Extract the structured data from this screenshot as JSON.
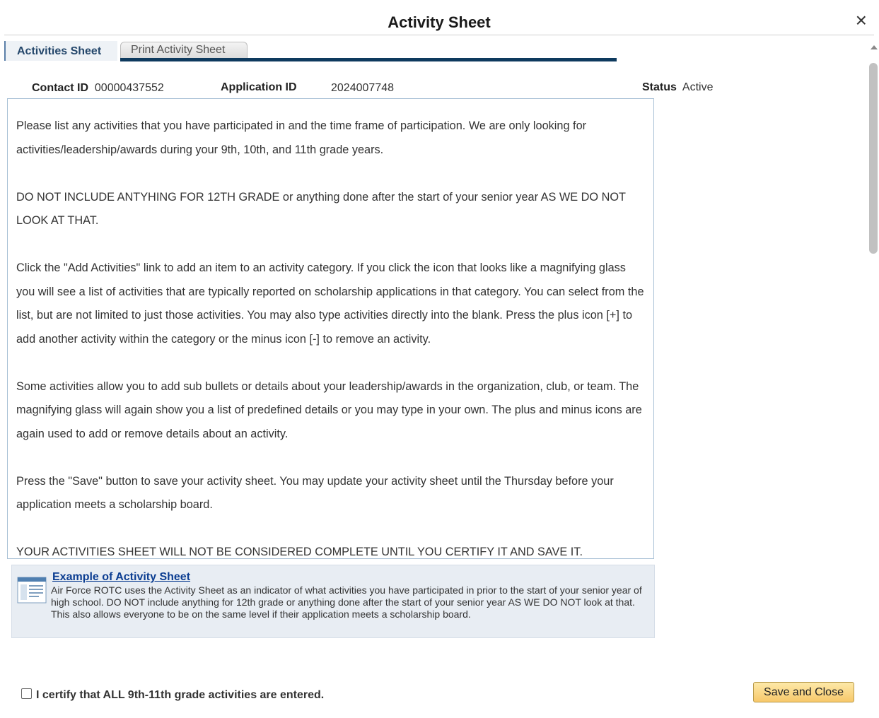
{
  "dialog": {
    "title": "Activity Sheet",
    "close_glyph": "×"
  },
  "tabs": [
    {
      "label": "Activities Sheet",
      "active": true
    },
    {
      "label": "Print Activity Sheet",
      "active": false
    }
  ],
  "ids": {
    "contact_label": "Contact ID",
    "contact_value": "00000437552",
    "application_label": "Application ID",
    "application_value": "2024007748",
    "status_label": "Status",
    "status_value": "Active"
  },
  "instructions": [
    "Please list any activities that you have participated in and the time frame of participation. We are only looking for activities/leadership/awards during your 9th, 10th, and 11th grade years.",
    "DO NOT INCLUDE ANTYHING FOR 12TH GRADE or anything done after the start of your senior year AS WE DO NOT LOOK AT THAT.",
    "Click the \"Add Activities\" link to add an item to an activity category. If you click the icon that looks like a magnifying glass you will see a list of activities that are typically reported on scholarship applications in that category. You can select from the list, but are not limited to just those activities. You may also type activities directly into the blank. Press the plus icon [+] to add another activity within the category or the minus icon [-] to remove an activity.",
    "Some activities allow you to add sub bullets or details about your leadership/awards in the organization, club, or team. The magnifying glass will again show you a list of predefined details or you may type in your own. The plus and minus icons are again used to add or remove details about an activity.",
    "Press the \"Save\" button to save your activity sheet. You may update your activity sheet until the Thursday before your application meets a scholarship board.",
    "YOUR ACTIVITIES SHEET WILL NOT BE CONSIDERED COMPLETE UNTIL YOU CERTIFY IT AND SAVE IT."
  ],
  "example": {
    "link": "Example of Activity Sheet",
    "text": "Air Force ROTC uses the Activity Sheet as an indicator of what activities you have participated in prior to the start of your senior year of high school. DO NOT include anything for 12th grade or anything done after the start of your senior year AS WE DO NOT look at that. This also allows everyone to be on the same level if their application meets a scholarship board."
  },
  "certify": {
    "label": "I certify that ALL 9th-11th grade activities are entered.",
    "checked": false
  },
  "actions": {
    "save_close": "Save and Close"
  },
  "icons": {
    "close": "close-icon",
    "document": "document-icon"
  }
}
